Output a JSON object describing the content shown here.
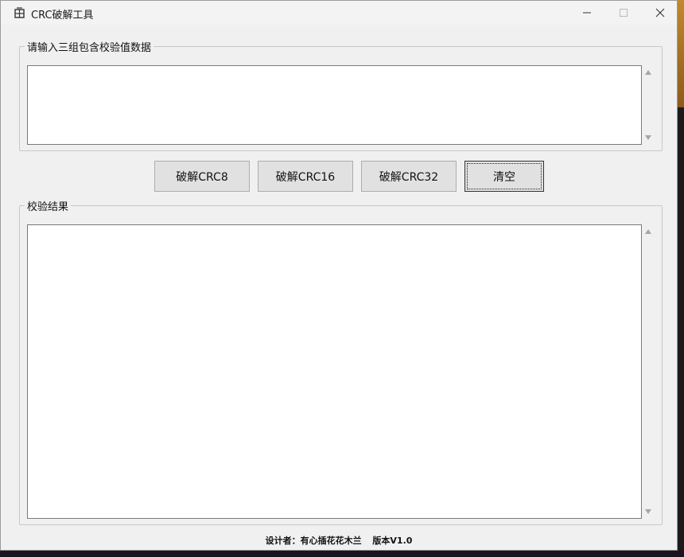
{
  "window": {
    "title": "CRC破解工具",
    "minimize_icon": "minimize-icon",
    "maximize_icon": "maximize-icon",
    "close_icon": "close-icon"
  },
  "input_group": {
    "legend": "请输入三组包含校验值数据",
    "value": ""
  },
  "buttons": {
    "crc8": "破解CRC8",
    "crc16": "破解CRC16",
    "crc32": "破解CRC32",
    "clear": "清空"
  },
  "result_group": {
    "legend": "校验结果",
    "value": ""
  },
  "footer": {
    "designer": "设计者：有心插花花木兰",
    "version": "版本V1.0"
  }
}
